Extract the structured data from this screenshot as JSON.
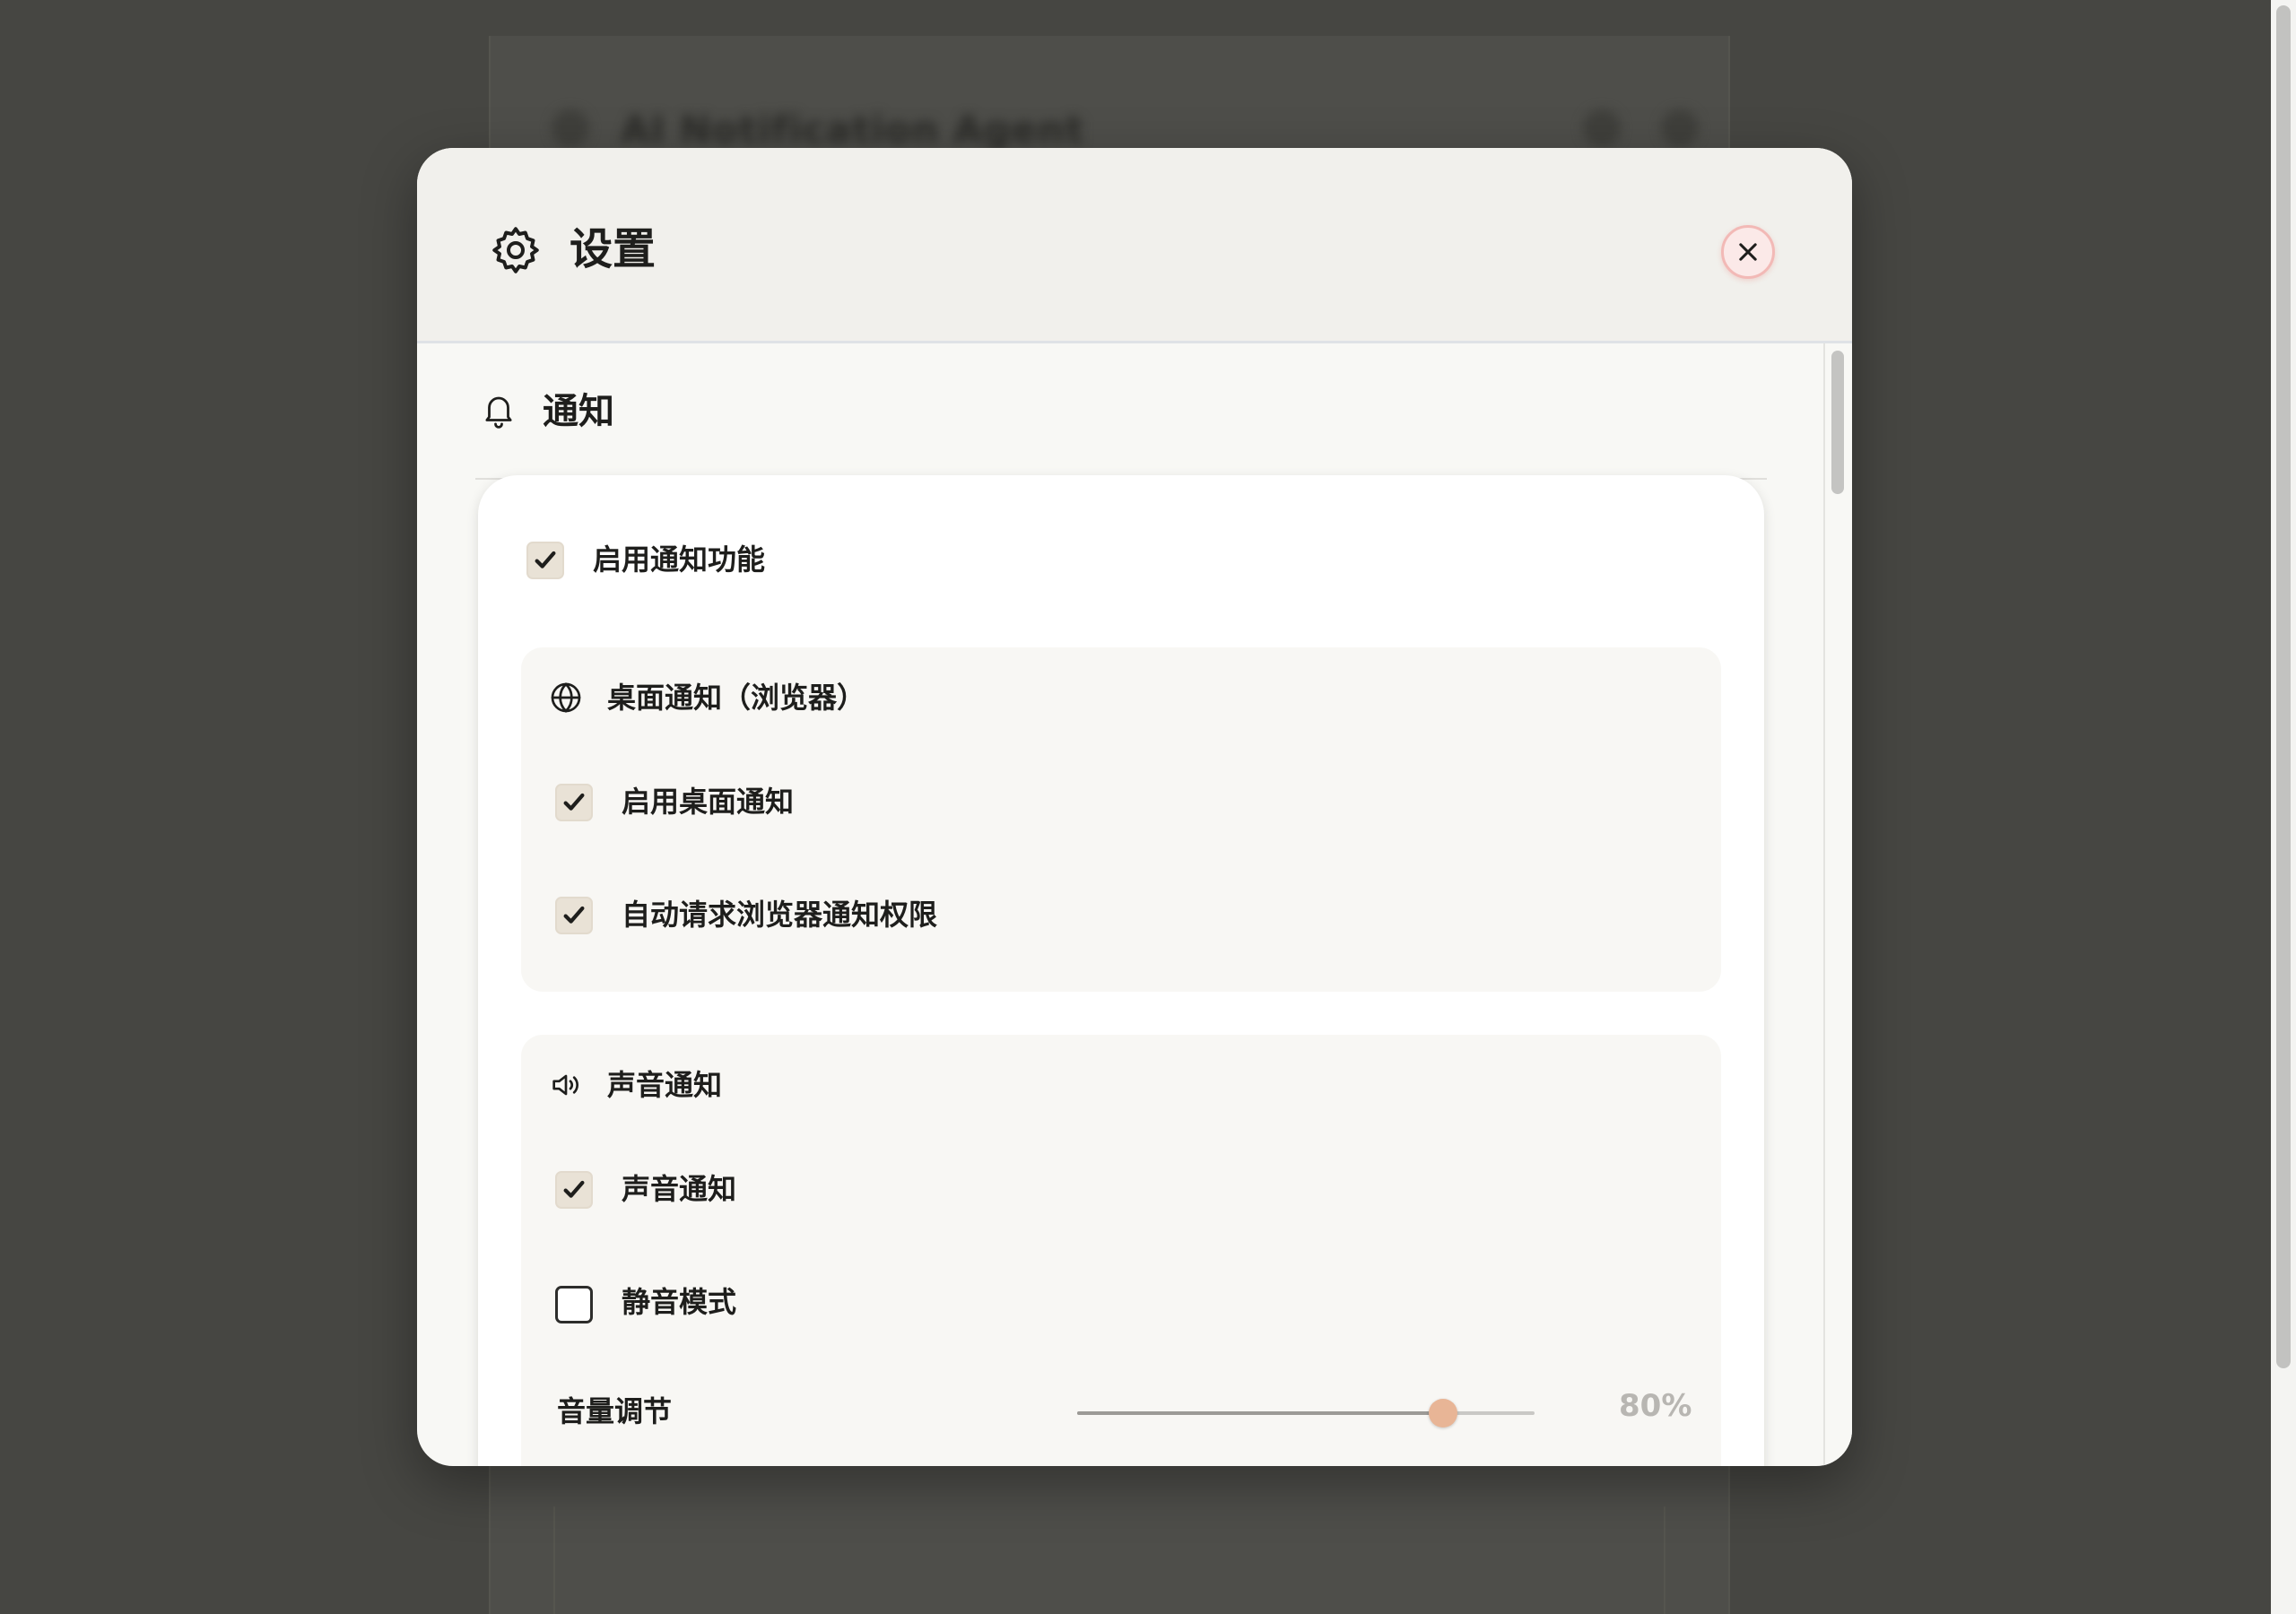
{
  "background": {
    "app_title": "AI Notification Agent"
  },
  "modal": {
    "title": "设置",
    "header_icon": "gear-icon",
    "close_icon": "close-icon"
  },
  "notifications": {
    "section_title": "通知",
    "section_icon": "bell-icon",
    "enable_label": "启用通知功能",
    "enable_checked": true,
    "desktop": {
      "title": "桌面通知（浏览器）",
      "icon": "globe-icon",
      "enable_desktop_label": "启用桌面通知",
      "enable_desktop_checked": true,
      "auto_request_label": "自动请求浏览器通知权限",
      "auto_request_checked": true
    },
    "sound": {
      "title": "声音通知",
      "icon": "speaker-icon",
      "sound_label": "声音通知",
      "sound_checked": true,
      "mute_label": "静音模式",
      "mute_checked": false,
      "volume_label": "音量调节",
      "volume_value": 0.8,
      "volume_text": "80%"
    }
  },
  "colors": {
    "accent_thumb": "#e8b596",
    "close_bg": "#fbe9e8",
    "close_border": "#f2b9b6",
    "checkbox_on": "#e9e2d6"
  }
}
